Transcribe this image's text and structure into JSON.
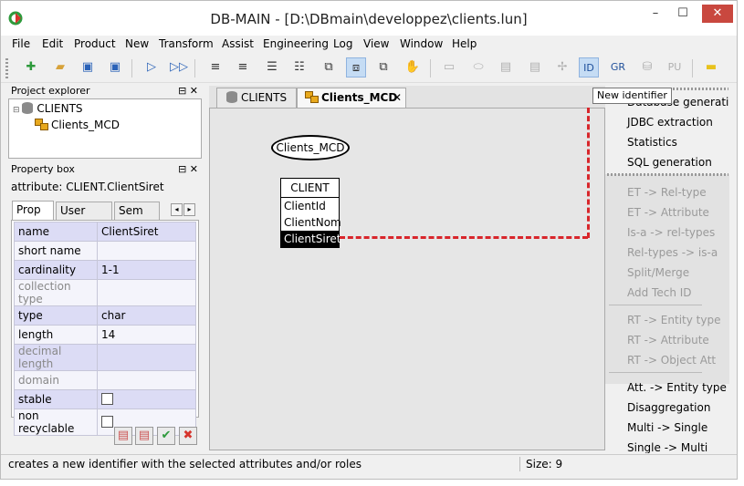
{
  "window": {
    "title": "DB-MAIN  - [D:\\DBmain\\developpez\\clients.lun]",
    "min_label": "–",
    "max_label": "☐",
    "close_label": "✕"
  },
  "menu": [
    "File",
    "Edit",
    "Product",
    "New",
    "Transform",
    "Assist",
    "Engineering",
    "Log",
    "View",
    "Window",
    "Help"
  ],
  "toolbar": {
    "id_label": "ID",
    "gr_label": "GR",
    "pu_label": "PU",
    "tooltip": "New identifier"
  },
  "project_explorer": {
    "title": "Project explorer",
    "root": "CLIENTS",
    "child": "Clients_MCD",
    "controls": "⊟ ✕"
  },
  "property_box": {
    "title": "Property box",
    "controls": "⊟ ✕",
    "attribute": "attribute: CLIENT.ClientSiret",
    "tabs": [
      "Prop",
      "User prop",
      "Sem"
    ],
    "rows": [
      {
        "key": "name",
        "value": "ClientSiret"
      },
      {
        "key": "short name",
        "value": ""
      },
      {
        "key": "cardinality",
        "value": "1-1"
      },
      {
        "key": "collection type",
        "value": ""
      },
      {
        "key": "type",
        "value": "char"
      },
      {
        "key": "length",
        "value": "14"
      },
      {
        "key": "decimal length",
        "value": ""
      },
      {
        "key": "domain",
        "value": ""
      },
      {
        "key": "stable",
        "value": ""
      },
      {
        "key": "non recyclable",
        "value": ""
      }
    ]
  },
  "doc_tabs": [
    "CLIENTS",
    "Clients_MCD"
  ],
  "canvas": {
    "schema_name": "Clients_MCD",
    "entity": {
      "name": "CLIENT",
      "attributes": [
        "ClientId",
        "ClientNom",
        "ClientSiret"
      ]
    }
  },
  "right_panel": {
    "group1": [
      "Database generation",
      "JDBC extraction",
      "Statistics",
      "SQL generation"
    ],
    "group2": [
      "ET -> Rel-type",
      "ET -> Attribute",
      "Is-a -> rel-types",
      "Rel-types -> is-a",
      "Split/Merge",
      "Add Tech ID"
    ],
    "group3": [
      "RT -> Entity type",
      "RT -> Attribute",
      "RT -> Object Att"
    ],
    "group4": [
      "Att. -> Entity type",
      "Disaggregation",
      "Multi -> Single",
      "Single -> Multi"
    ]
  },
  "status": {
    "message": "creates a new identifier with the selected attributes and/or roles",
    "size": "Size: 9"
  },
  "colors": {
    "close": "#c9483f",
    "dashed_link": "#d8262b",
    "selected_row": "#dcdcf5"
  }
}
